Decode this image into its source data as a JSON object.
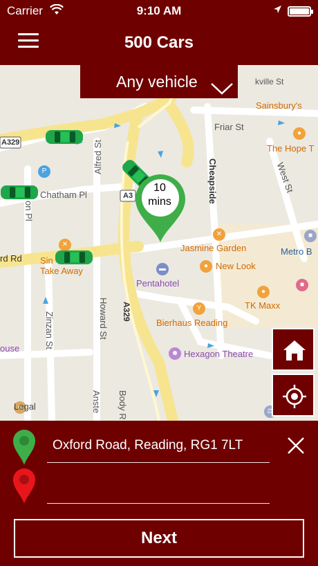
{
  "status_bar": {
    "carrier": "Carrier",
    "time": "9:10 AM",
    "wifi_icon": "wifi-icon",
    "location_icon": "location-arrow-icon",
    "battery_level": 1.0
  },
  "nav": {
    "title": "500 Cars",
    "menu_icon": "hamburger-menu-icon"
  },
  "vehicle_select": {
    "value": "Any vehicle",
    "icon": "chevron-down-icon"
  },
  "map": {
    "labels": {
      "friar_st": "Friar St",
      "sainsburys": "Sainsbury's",
      "the_hope": "The Hope T",
      "a329_top": "A329",
      "a329_mid": "A3",
      "a329_south": "A329",
      "chatham_pl": "Chatham Pl",
      "alfred_st": "Alfred St",
      "cheapside": "Cheapside",
      "west_st": "West St",
      "jasmine": "Jasmine Garden",
      "new_look": "New Look",
      "metro": "Metro B",
      "pentahotel": "Pentahotel",
      "tk_maxx": "TK Maxx",
      "bierhaus": "Bierhaus Reading",
      "hexagon": "Hexagon Theatre",
      "howard_st": "Howard St",
      "zinzan_st": "Zinzan St",
      "ord_rd": "rd Rd",
      "take_away_1": "Sin",
      "take_away_2": "Take Away",
      "ouse": "ouse",
      "legal": "Legal",
      "body_r": "Body R",
      "anste": "Anste",
      "kville": "kville St",
      "on_pl": "on Pl"
    },
    "eta": {
      "value": "10",
      "unit": "mins"
    }
  },
  "side_buttons": {
    "home_icon": "home-icon",
    "locate_icon": "crosshair-icon"
  },
  "pickup": {
    "address": "Oxford Road, Reading, RG1 7LT",
    "icon": "map-pin-icon",
    "color": "#3fae49"
  },
  "dropoff": {
    "address": "",
    "icon": "map-pin-icon",
    "color": "#e8161b"
  },
  "clear_icon": "close-icon",
  "next_button": {
    "label": "Next"
  },
  "colors": {
    "brand": "#6e0000",
    "car": "#1fa64a",
    "pin": "#3fae49"
  }
}
